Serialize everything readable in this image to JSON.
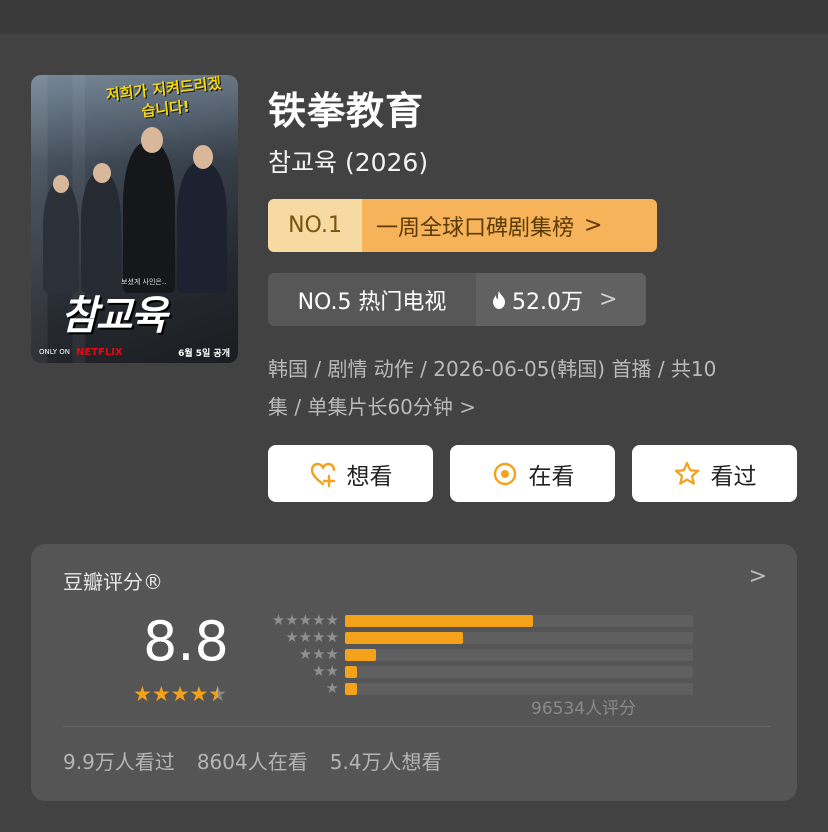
{
  "poster": {
    "tagline": "저희가 지켜드리겠습니다!",
    "title": "참교육",
    "small": "보셨게 사인은..",
    "only_on": "ONLY ON",
    "brand": "NETFLIX",
    "date": "6월 5일 공개"
  },
  "header": {
    "title_cn": "铁拳教育",
    "title_ko": "참교육 (2026)"
  },
  "rank_global": {
    "no": "NO.1",
    "label": "一周全球口碑剧集榜",
    "chevron": ">"
  },
  "rank_hot": {
    "no": "NO.5 热门电视",
    "heat": "52.0万",
    "chevron": ">"
  },
  "meta": {
    "line1": "韩国 / 剧情 动作 / 2026-06-05(韩国) 首播 / 共10",
    "line2": "集 / 单集片长60分钟 >"
  },
  "actions": {
    "want": "想看",
    "doing": "在看",
    "done": "看过"
  },
  "rating": {
    "card_title": "豆瓣评分®",
    "chevron": ">",
    "score": "8.8",
    "count": "96534人评分",
    "stars": "★★★★",
    "star_rows": [
      "★★★★★",
      "★★★★",
      "★★★",
      "★★",
      "★"
    ],
    "accent_color": "#f4a21a"
  },
  "chart_data": {
    "type": "bar",
    "categories": [
      "5 stars",
      "4 stars",
      "3 stars",
      "2 stars",
      "1 star"
    ],
    "values": [
      54,
      34,
      9,
      2,
      2
    ]
  },
  "stats": {
    "watched": "9.9万人看过",
    "watching": "8604人在看",
    "want": "5.4万人想看"
  }
}
